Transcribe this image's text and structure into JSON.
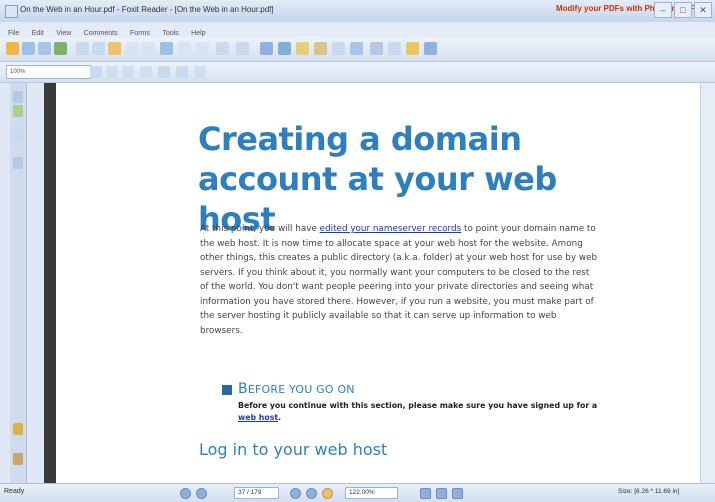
{
  "window": {
    "title": "On the Web in an Hour.pdf - Foxit Reader - [On the Web in an Hour.pdf]",
    "ad_text": "Modify your PDFs with PhantomPDF"
  },
  "menu": [
    "File",
    "Edit",
    "View",
    "Comments",
    "Forms",
    "Tools",
    "Help"
  ],
  "toolbar2": {
    "zoom_combo_value": "100%"
  },
  "document": {
    "heading": "Creating a domain account at your web host",
    "paragraph": {
      "before_link": "At this point, you will have ",
      "link": "edited your nameserver records",
      "after_link": " to point your domain name to the web host. It is now time to allocate space at your web host for the website. Among other things, this creates a public directory (a.k.a. folder) at your web host for use by web servers. If you think about it, you normally want your computers to be closed to the rest of the world. You don't want people peering into your private directories and seeing what information you have stored there. However, if you run a website, you must make part of the server hosting it publicly available so that it can serve up information to web browsers."
    },
    "before_heading": "Before you go on",
    "before_heading_first": "B",
    "before_heading_rest": "EFORE YOU GO ON",
    "note": {
      "text": "Before you continue with this section, please make sure you have signed up for a ",
      "link": "web host",
      "end": "."
    },
    "subheading": "Log in to your web host"
  },
  "status": {
    "ready": "Ready",
    "page": "37 / 179",
    "zoom": "122.00%",
    "page_size": "Size: [8.26 * 11.69 in]"
  },
  "colors": {
    "heading": "#2e7fbf",
    "link": "#1a37c9",
    "bullet": "#2a67a3"
  }
}
